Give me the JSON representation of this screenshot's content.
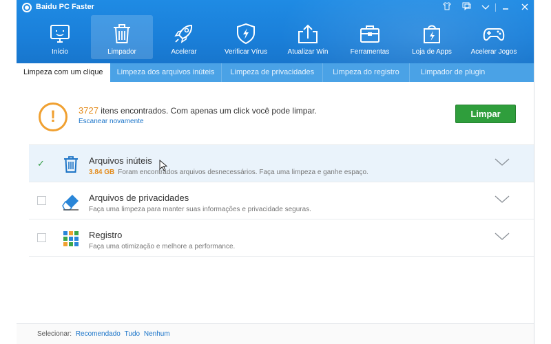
{
  "app": {
    "title": "Baidu PC Faster"
  },
  "nav": [
    {
      "label": "Início",
      "icon": "monitor-smile-icon"
    },
    {
      "label": "Limpador",
      "icon": "trash-icon",
      "active": true
    },
    {
      "label": "Acelerar",
      "icon": "rocket-icon"
    },
    {
      "label": "Verificar Vírus",
      "icon": "shield-bolt-icon"
    },
    {
      "label": "Atualizar Win",
      "icon": "upload-icon"
    },
    {
      "label": "Ferramentas",
      "icon": "toolbox-icon"
    },
    {
      "label": "Loja de Apps",
      "icon": "shopping-bag-icon"
    },
    {
      "label": "Acelerar Jogos",
      "icon": "gamepad-icon"
    }
  ],
  "tabs": [
    "Limpeza com um clique",
    "Limpeza dos arquivos inúteis",
    "Limpeza de privacidades",
    "Limpeza do registro",
    "Limpador de plugin"
  ],
  "banner": {
    "count": "3727",
    "message": " itens encontrados. Com apenas um click você pode limpar.",
    "rescan": "Escanear novamente",
    "button": "Limpar"
  },
  "items": [
    {
      "title": "Arquivos inúteis",
      "size": "3.84 GB",
      "desc": "Foram encontrados arquivos desnecessários. Faça uma limpeza e ganhe espaço.",
      "checked": true
    },
    {
      "title": "Arquivos de privacidades",
      "desc": "Faça uma limpeza para manter suas informações e privacidade seguras.",
      "checked": false
    },
    {
      "title": "Registro",
      "desc": "Faça uma otimização e melhore a performance.",
      "checked": false
    }
  ],
  "footer": {
    "label": "Selecionar:",
    "links": [
      "Recomendado",
      "Tudo",
      "Nenhum"
    ]
  },
  "colors": {
    "brand_blue": "#1a7fd9",
    "tab_blue": "#4aa2e6",
    "accent_orange": "#e38b1b",
    "button_green": "#2f9e3c"
  }
}
